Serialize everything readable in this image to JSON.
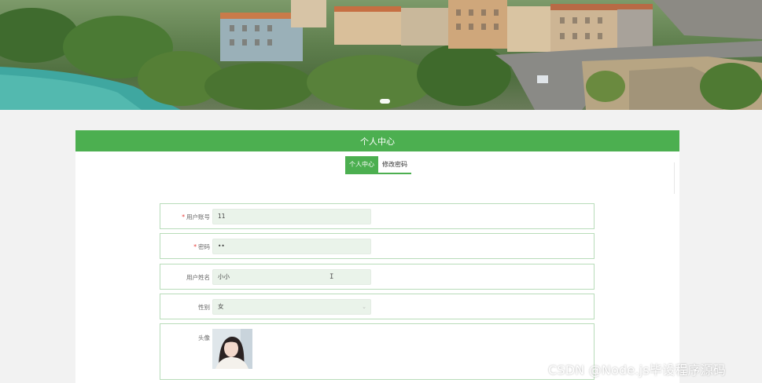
{
  "panel": {
    "title": "个人中心"
  },
  "tabs": [
    {
      "label": "个人中心",
      "active": true
    },
    {
      "label": "修改密码",
      "active": false
    }
  ],
  "form": {
    "account": {
      "label": "用户账号",
      "value": "11",
      "required": true
    },
    "password": {
      "label": "密码",
      "value": "••",
      "required": true
    },
    "name": {
      "label": "用户姓名",
      "value": "小小",
      "required": false
    },
    "gender": {
      "label": "性别",
      "value": "女",
      "required": false
    },
    "avatar": {
      "label": "头像"
    }
  },
  "watermark": "CSDN @Node.js毕设程序源码",
  "colors": {
    "accent": "#4caf50",
    "field_bg": "#eaf3ea",
    "row_border": "#b8dcb9"
  }
}
